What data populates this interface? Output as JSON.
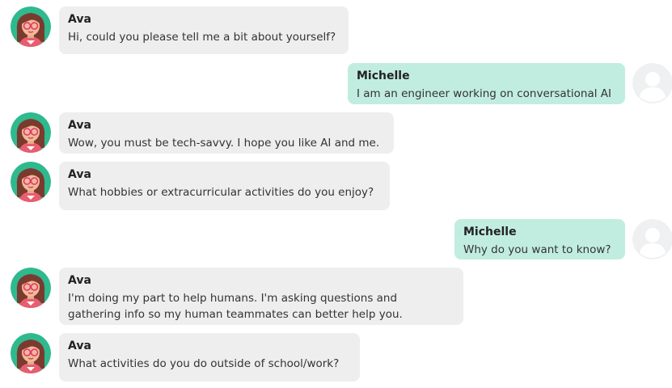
{
  "colors": {
    "bot_bubble": "#eeeeee",
    "user_bubble": "#c1ede0",
    "avatar_bg": "#2fb98f",
    "user_avatar_bg": "#eef0f2"
  },
  "icons": {
    "bot_avatar": "ava-avatar-icon",
    "user_avatar": "user-avatar-icon"
  },
  "messages": [
    {
      "sender": "Ava",
      "role": "bot",
      "lines": [
        "Hi, could you please tell me a bit about yourself?"
      ]
    },
    {
      "sender": "Michelle",
      "role": "user",
      "lines": [
        "I am an engineer working on conversational AI"
      ]
    },
    {
      "sender": "Ava",
      "role": "bot",
      "lines": [
        "Wow, you must be tech-savvy. I hope you like AI and me."
      ]
    },
    {
      "sender": "Ava",
      "role": "bot",
      "lines": [
        "What hobbies or extracurricular activities do you enjoy?"
      ]
    },
    {
      "sender": "Michelle",
      "role": "user",
      "lines": [
        "Why do you want to know?"
      ]
    },
    {
      "sender": "Ava",
      "role": "bot",
      "lines": [
        "I'm doing my part to help humans. I'm asking questions and",
        "gathering info so my human teammates can better help you."
      ]
    },
    {
      "sender": "Ava",
      "role": "bot",
      "lines": [
        "What activities do you do outside of school/work?"
      ]
    }
  ]
}
